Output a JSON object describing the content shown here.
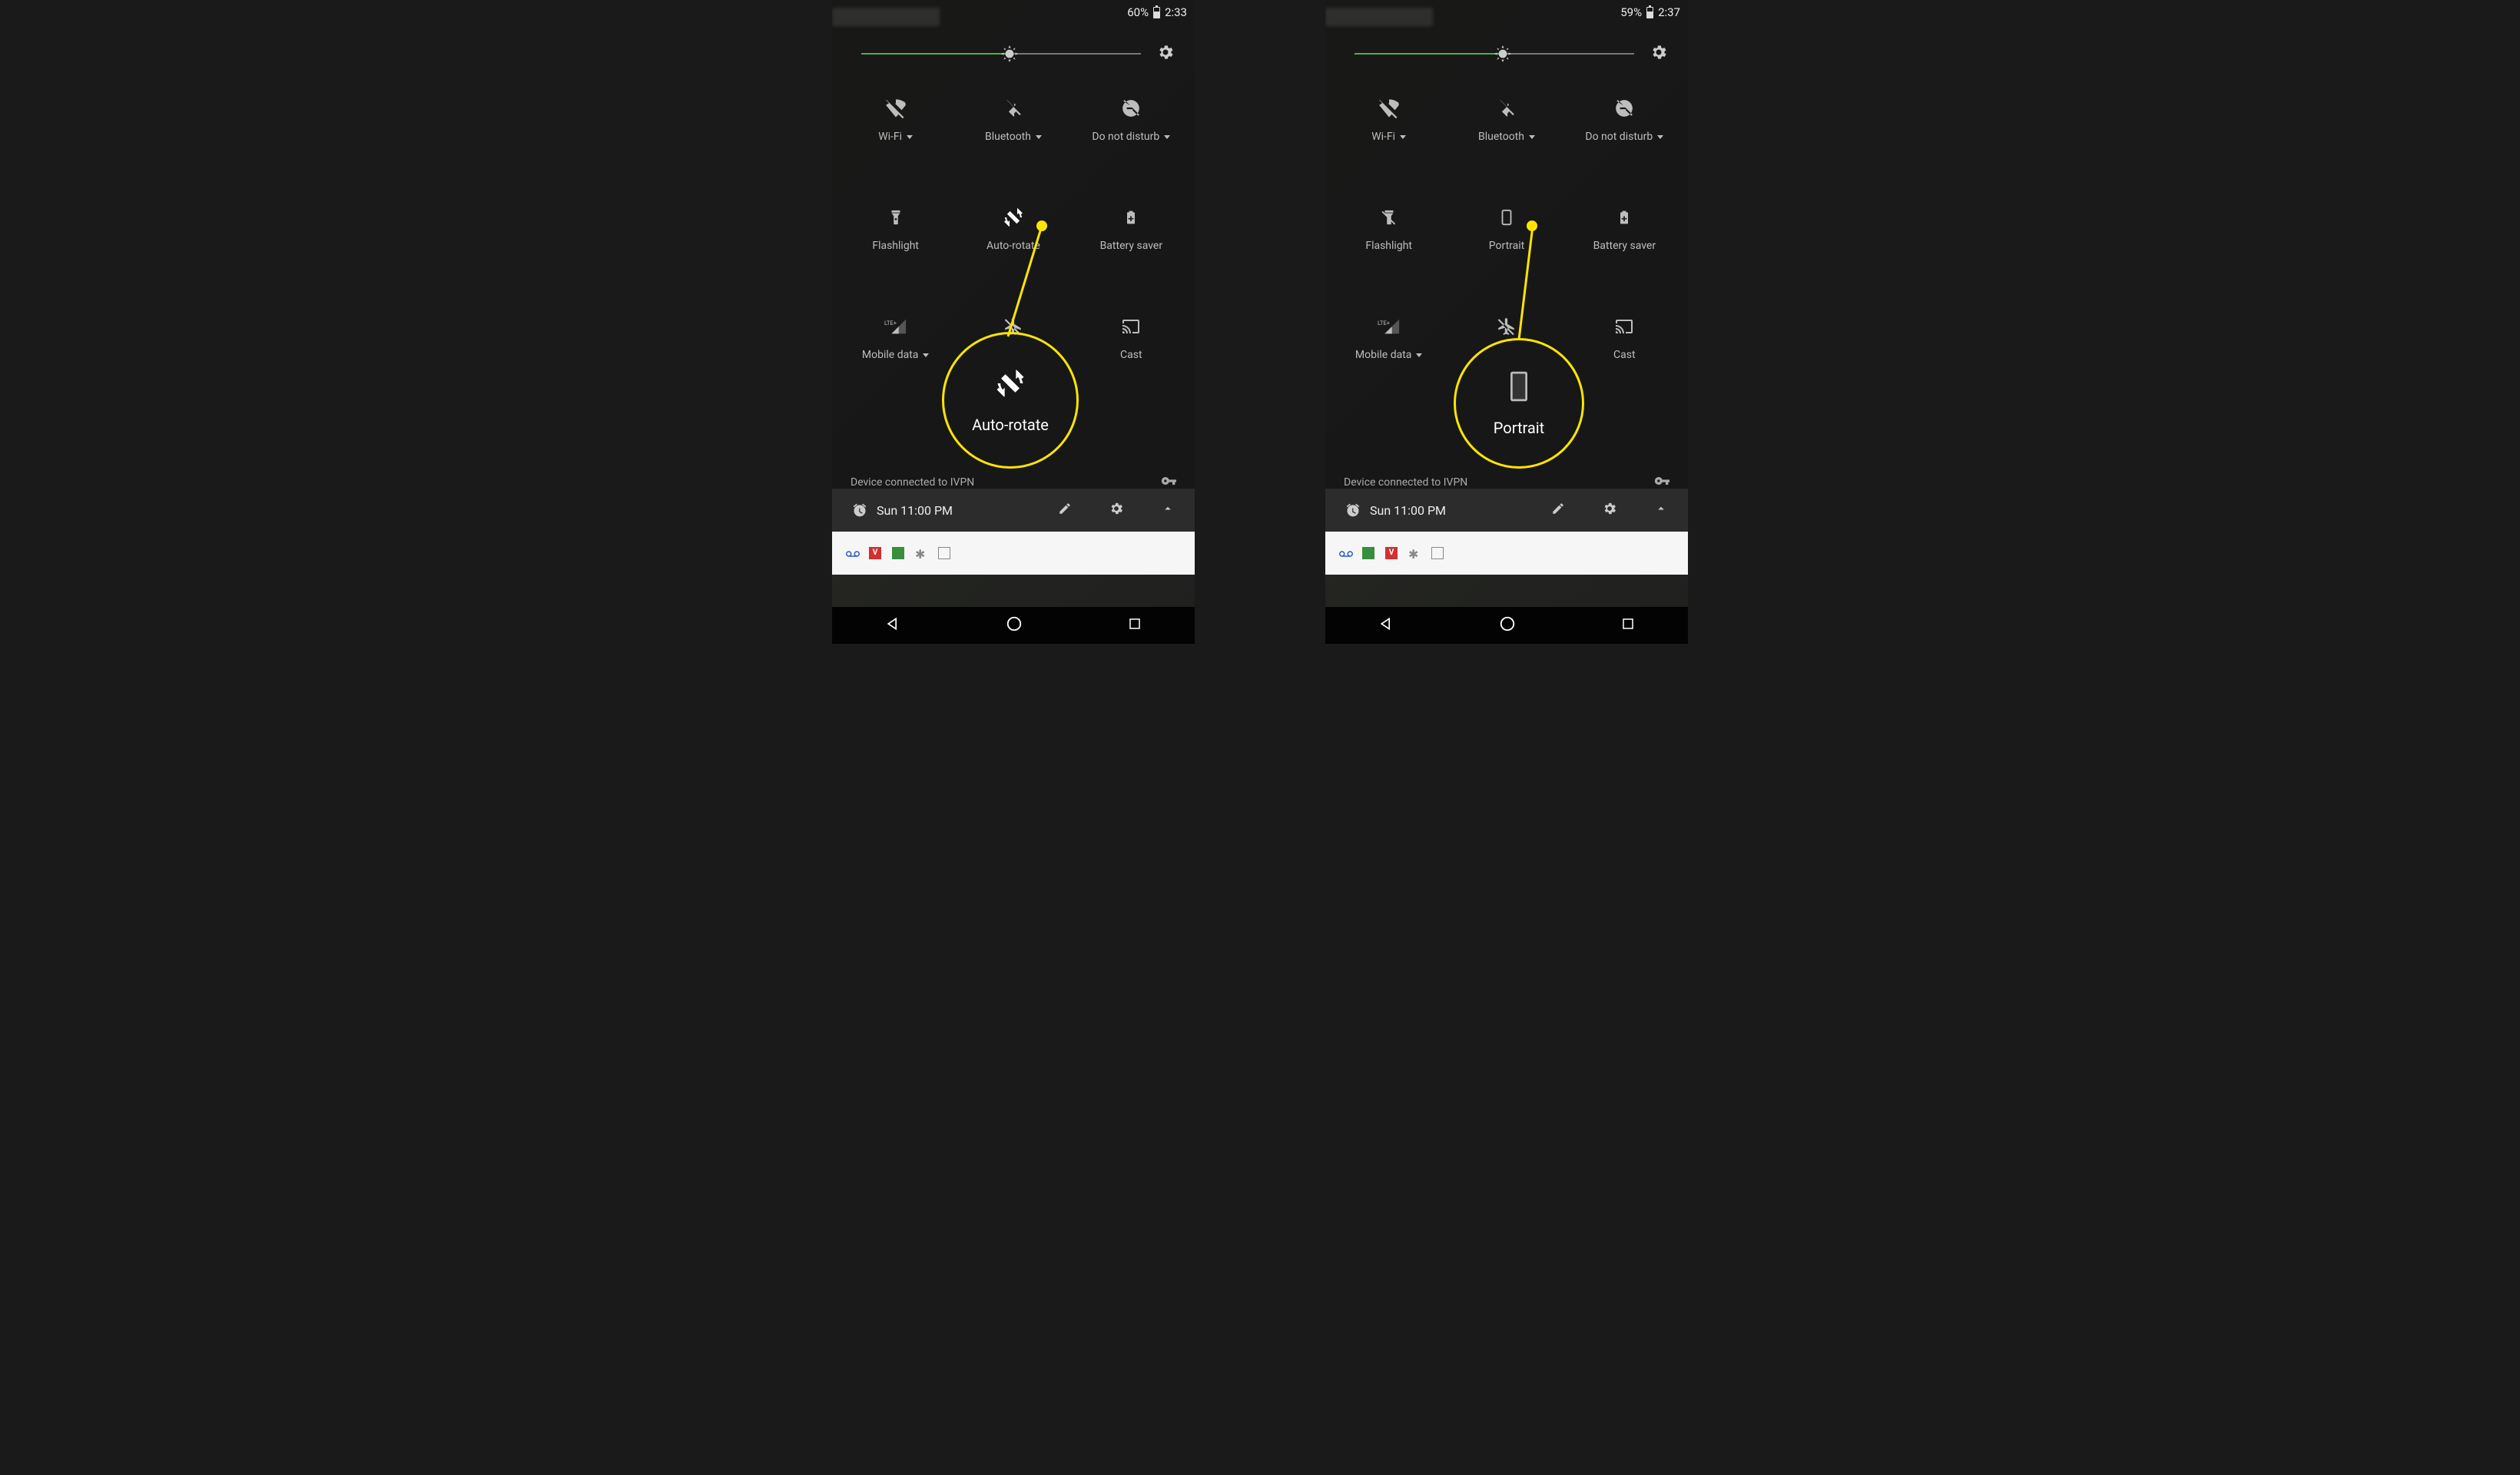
{
  "left": {
    "statusbar": {
      "battery_pct": "60%",
      "time": "2:33",
      "battery_fill_pct": 60
    },
    "brightness_pct": 53,
    "tiles": {
      "wifi": {
        "label": "Wi-Fi",
        "has_caret": true
      },
      "bluetooth": {
        "label": "Bluetooth",
        "has_caret": true
      },
      "dnd": {
        "label": "Do not disturb",
        "has_caret": true
      },
      "flashlight": {
        "label": "Flashlight"
      },
      "rotate": {
        "label": "Auto-rotate",
        "mode": "auto"
      },
      "battery_saver": {
        "label": "Battery saver"
      },
      "mobile_data": {
        "label": "Mobile data",
        "has_caret": true,
        "signal": "LTE+"
      },
      "airplane": {
        "label": ""
      },
      "cast": {
        "label": "Cast"
      }
    },
    "vpn_text": "Device connected to IVPN",
    "alarm_text": "Sun 11:00 PM",
    "callout_label": "Auto-rotate"
  },
  "right": {
    "statusbar": {
      "battery_pct": "59%",
      "time": "2:37",
      "battery_fill_pct": 59
    },
    "brightness_pct": 53,
    "tiles": {
      "wifi": {
        "label": "Wi-Fi",
        "has_caret": true
      },
      "bluetooth": {
        "label": "Bluetooth",
        "has_caret": true
      },
      "dnd": {
        "label": "Do not disturb",
        "has_caret": true
      },
      "flashlight": {
        "label": "Flashlight"
      },
      "rotate": {
        "label": "Portrait",
        "mode": "portrait"
      },
      "battery_saver": {
        "label": "Battery saver"
      },
      "mobile_data": {
        "label": "Mobile data",
        "has_caret": true,
        "signal": "LTE+"
      },
      "airplane": {
        "label": ""
      },
      "cast": {
        "label": "Cast"
      }
    },
    "vpn_text": "Device connected to IVPN",
    "alarm_text": "Sun 11:00 PM",
    "callout_label": "Portrait"
  }
}
